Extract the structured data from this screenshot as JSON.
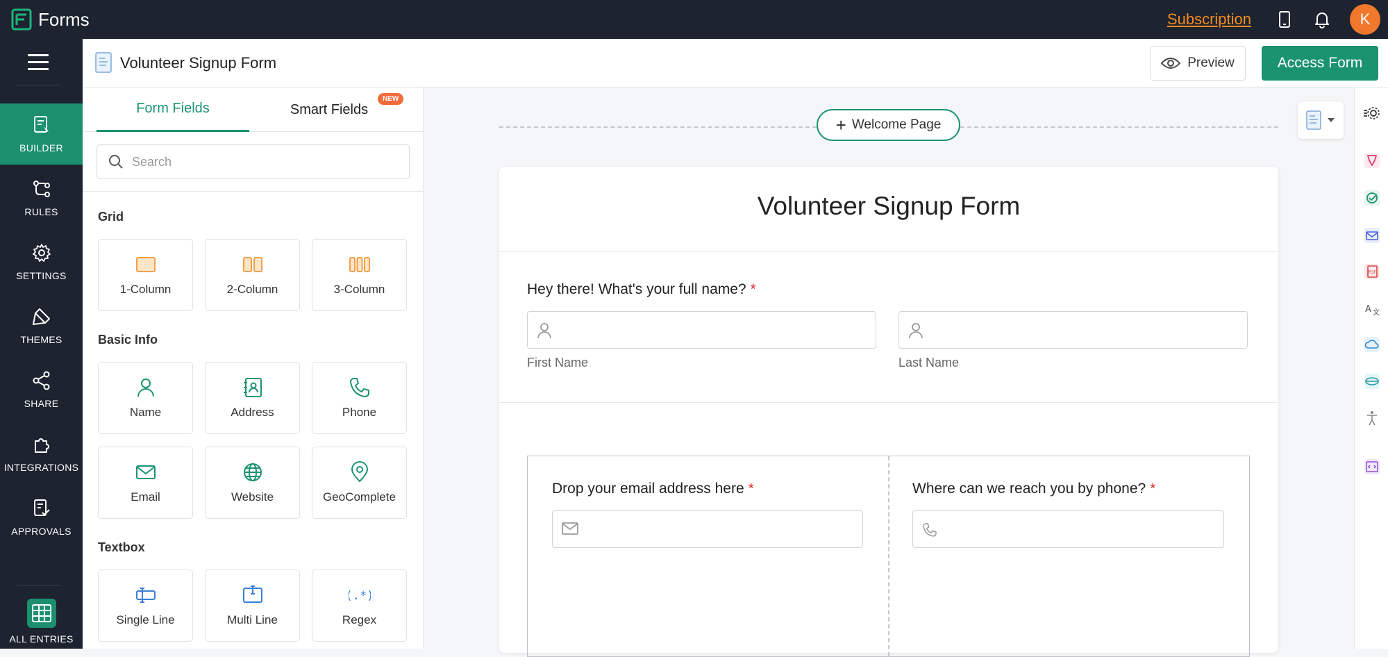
{
  "app": {
    "name": "Forms"
  },
  "topbar": {
    "subscription_label": "Subscription",
    "avatar_letter": "K"
  },
  "nav": {
    "items": [
      {
        "label": "BUILDER"
      },
      {
        "label": "RULES"
      },
      {
        "label": "SETTINGS"
      },
      {
        "label": "THEMES"
      },
      {
        "label": "SHARE"
      },
      {
        "label": "INTEGRATIONS"
      },
      {
        "label": "APPROVALS"
      },
      {
        "label": "ALL ENTRIES"
      }
    ]
  },
  "header": {
    "form_title": "Volunteer Signup Form",
    "preview_label": "Preview",
    "access_label": "Access Form"
  },
  "panel": {
    "tabs": [
      {
        "label": "Form Fields"
      },
      {
        "label": "Smart Fields"
      }
    ],
    "new_badge": "NEW",
    "search_placeholder": "Search",
    "sections": [
      {
        "title": "Grid",
        "items": [
          {
            "label": "1-Column"
          },
          {
            "label": "2-Column"
          },
          {
            "label": "3-Column"
          }
        ]
      },
      {
        "title": "Basic Info",
        "items": [
          {
            "label": "Name"
          },
          {
            "label": "Address"
          },
          {
            "label": "Phone"
          },
          {
            "label": "Email"
          },
          {
            "label": "Website"
          },
          {
            "label": "GeoComplete"
          }
        ]
      },
      {
        "title": "Textbox",
        "items": [
          {
            "label": "Single Line"
          },
          {
            "label": "Multi Line"
          },
          {
            "label": "Regex"
          }
        ]
      }
    ]
  },
  "canvas": {
    "welcome_label": "Welcome Page",
    "form_heading": "Volunteer Signup Form",
    "fields": [
      {
        "question": "Hey there! What's your full name?",
        "required": "*",
        "first_label": "First Name",
        "last_label": "Last Name"
      },
      {
        "question": "Drop your email address here",
        "required": "*"
      },
      {
        "question": "Where can we reach you by phone?",
        "required": "*"
      }
    ]
  },
  "colors": {
    "accent": "#1b9370",
    "topbar": "#1e2330",
    "subscription": "#f28c1e",
    "avatar": "#f0782c",
    "required": "#e02727"
  }
}
